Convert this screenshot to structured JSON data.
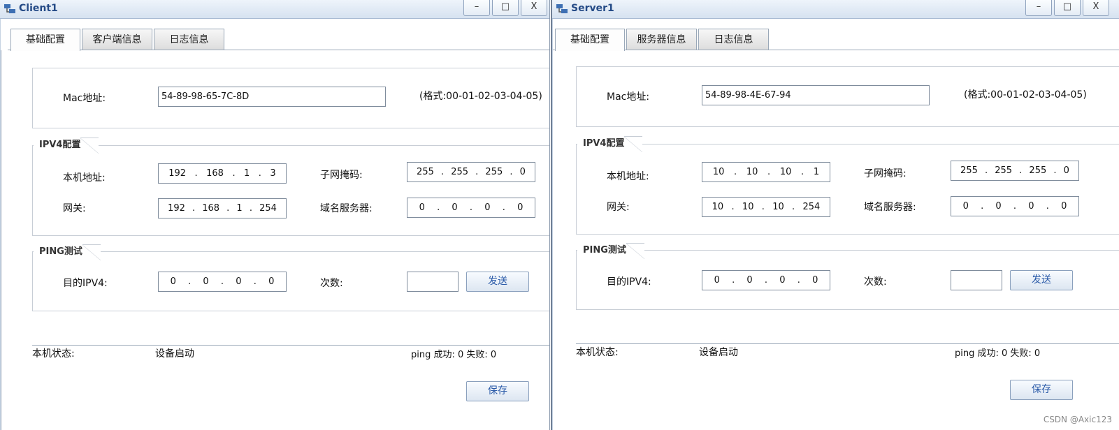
{
  "windows": [
    {
      "title": "Client1",
      "tabs": [
        "基础配置",
        "客户端信息",
        "日志信息"
      ],
      "mac_label": "Mac地址:",
      "mac_value": "54-89-98-65-7C-8D",
      "mac_hint": "(格式:00-01-02-03-04-05)",
      "ipv4_section": "IPV4配置",
      "host_ip_label": "本机地址:",
      "host_ip": [
        "192",
        "168",
        "1",
        "3"
      ],
      "mask_label": "子网掩码:",
      "mask": [
        "255",
        "255",
        "255",
        "0"
      ],
      "gateway_label": "网关:",
      "gateway": [
        "192",
        "168",
        "1",
        "254"
      ],
      "dns_label": "域名服务器:",
      "dns": [
        "0",
        "0",
        "0",
        "0"
      ],
      "ping_section": "PING测试",
      "dest_label": "目的IPV4:",
      "dest": [
        "0",
        "0",
        "0",
        "0"
      ],
      "count_label": "次数:",
      "count_value": "",
      "send_button": "发送",
      "status_label": "本机状态:",
      "status_value": "设备启动",
      "ping_result": "ping 成功: 0 失败: 0",
      "save_button": "保存"
    },
    {
      "title": "Server1",
      "tabs": [
        "基础配置",
        "服务器信息",
        "日志信息"
      ],
      "mac_label": "Mac地址:",
      "mac_value": "54-89-98-4E-67-94",
      "mac_hint": "(格式:00-01-02-03-04-05)",
      "ipv4_section": "IPV4配置",
      "host_ip_label": "本机地址:",
      "host_ip": [
        "10",
        "10",
        "10",
        "1"
      ],
      "mask_label": "子网掩码:",
      "mask": [
        "255",
        "255",
        "255",
        "0"
      ],
      "gateway_label": "网关:",
      "gateway": [
        "10",
        "10",
        "10",
        "254"
      ],
      "dns_label": "域名服务器:",
      "dns": [
        "0",
        "0",
        "0",
        "0"
      ],
      "ping_section": "PING测试",
      "dest_label": "目的IPV4:",
      "dest": [
        "0",
        "0",
        "0",
        "0"
      ],
      "count_label": "次数:",
      "count_value": "",
      "send_button": "发送",
      "status_label": "本机状态:",
      "status_value": "设备启动",
      "ping_result": "ping 成功: 0 失败: 0",
      "save_button": "保存"
    }
  ],
  "window_controls": {
    "minimize": "–",
    "maximize": "□",
    "close": "X"
  },
  "watermark": "CSDN @Axic123",
  "icons": {
    "app": "network-host-icon"
  },
  "colors": {
    "title_text": "#244a86",
    "button_text": "#2a5aa8"
  }
}
